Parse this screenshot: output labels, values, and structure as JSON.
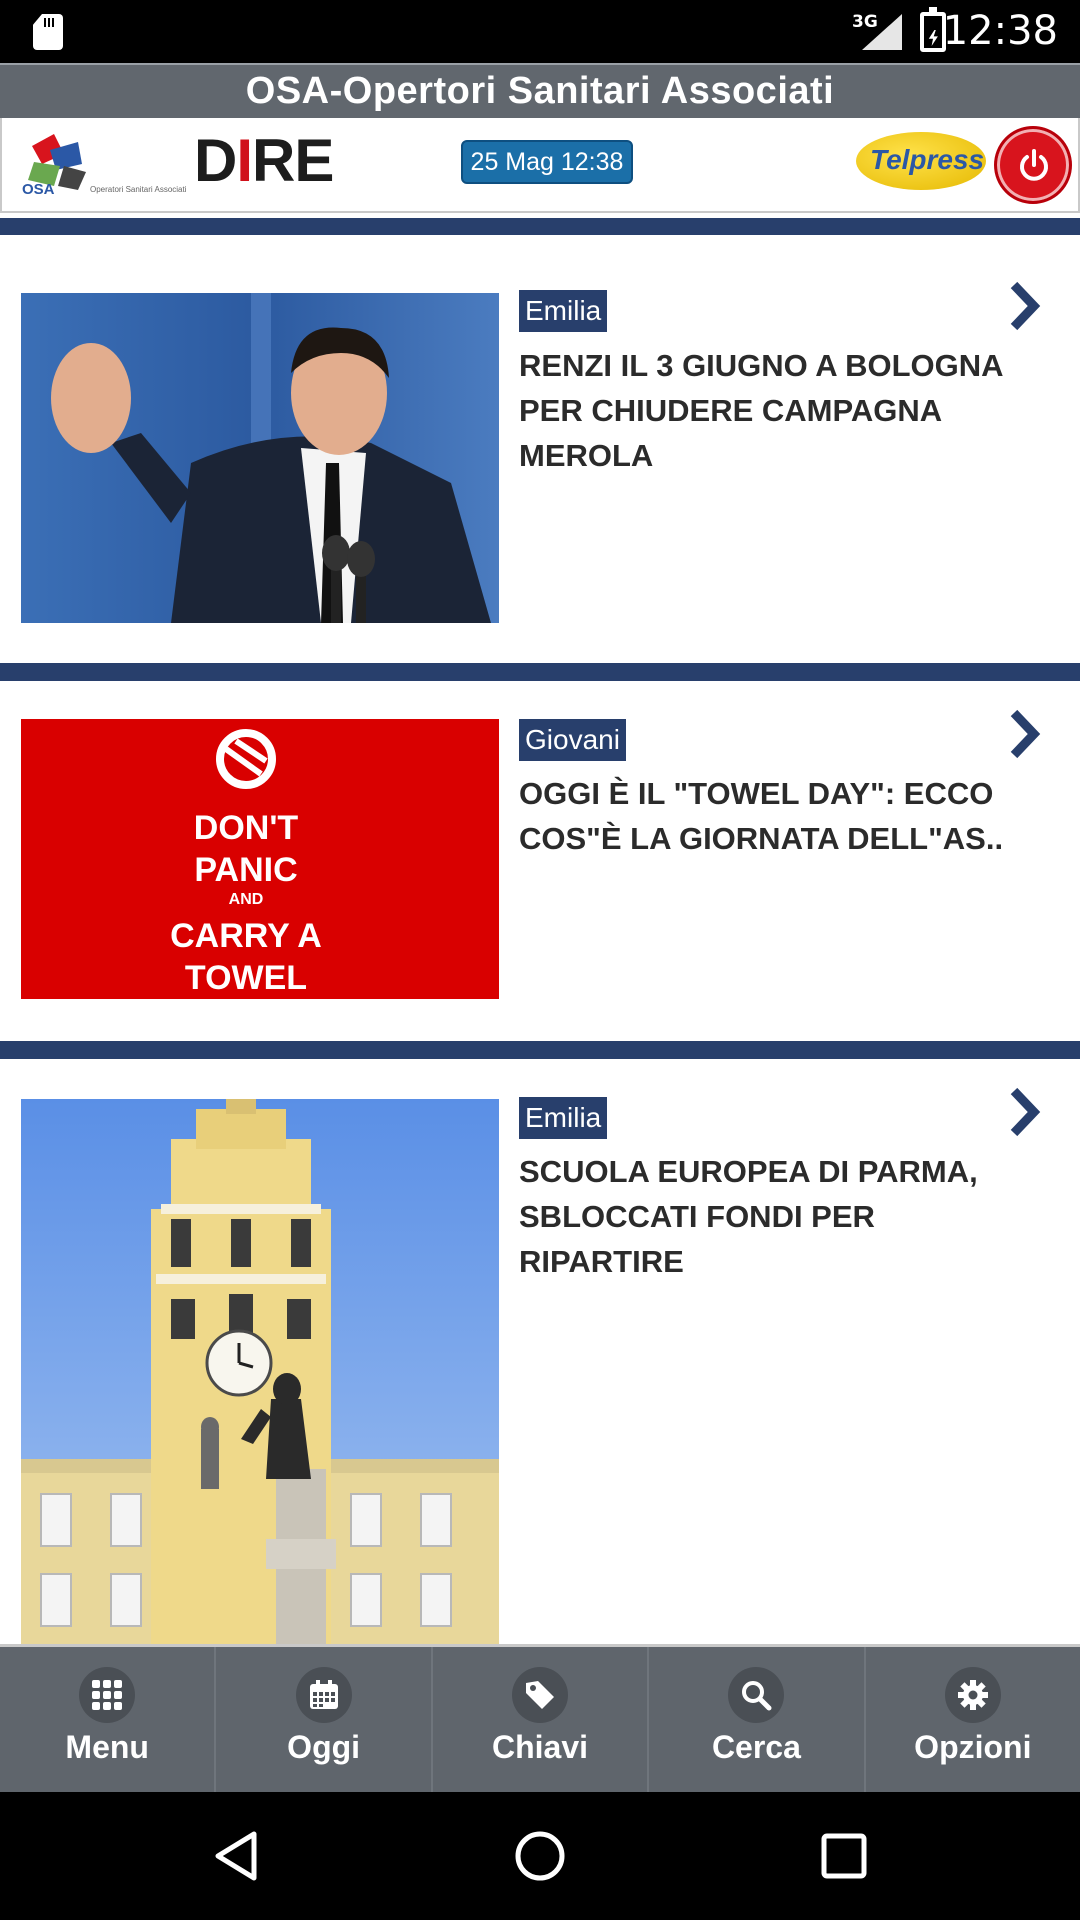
{
  "status_bar": {
    "network": "3G",
    "time": "12:38"
  },
  "app": {
    "title": "OSA-Opertori Sanitari Associati"
  },
  "logo_bar": {
    "osa_logo_text": "OSA",
    "osa_logo_subtext": "Operatori Sanitari Associati",
    "dire_logo_text": "DIRE",
    "date_badge": "25 Mag 12:38",
    "telpress_logo_text": "Telpress"
  },
  "feed": {
    "articles": [
      {
        "tag": "Emilia",
        "headline": "RENZI IL 3 GIUGNO A BOLOGNA PER CHIUDERE CAMPAGNA MEROLA",
        "image": "speaker-at-podium-photo"
      },
      {
        "tag": "Giovani",
        "headline": "OGGI È IL \"TOWEL DAY\": ECCO COS\"È LA GIORNATA DELL\"AS..",
        "image": "dont-panic-poster",
        "image_text": [
          "DON'T",
          "PANIC",
          "AND",
          "CARRY A",
          "TOWEL"
        ]
      },
      {
        "tag": "Emilia",
        "headline": "SCUOLA EUROPEA DI PARMA, SBLOCCATI FONDI PER RIPARTIRE",
        "image": "clock-tower-statue-photo"
      }
    ]
  },
  "bottom_nav": {
    "items": [
      {
        "label": "Menu",
        "icon": "grid-icon"
      },
      {
        "label": "Oggi",
        "icon": "calendar-icon"
      },
      {
        "label": "Chiavi",
        "icon": "tag-icon"
      },
      {
        "label": "Cerca",
        "icon": "search-icon"
      },
      {
        "label": "Opzioni",
        "icon": "gear-icon"
      }
    ]
  },
  "colors": {
    "accent_navy": "#283f6c",
    "header_gray": "#61676e",
    "power_red": "#d8141d",
    "date_blue": "#1b6fa8"
  }
}
